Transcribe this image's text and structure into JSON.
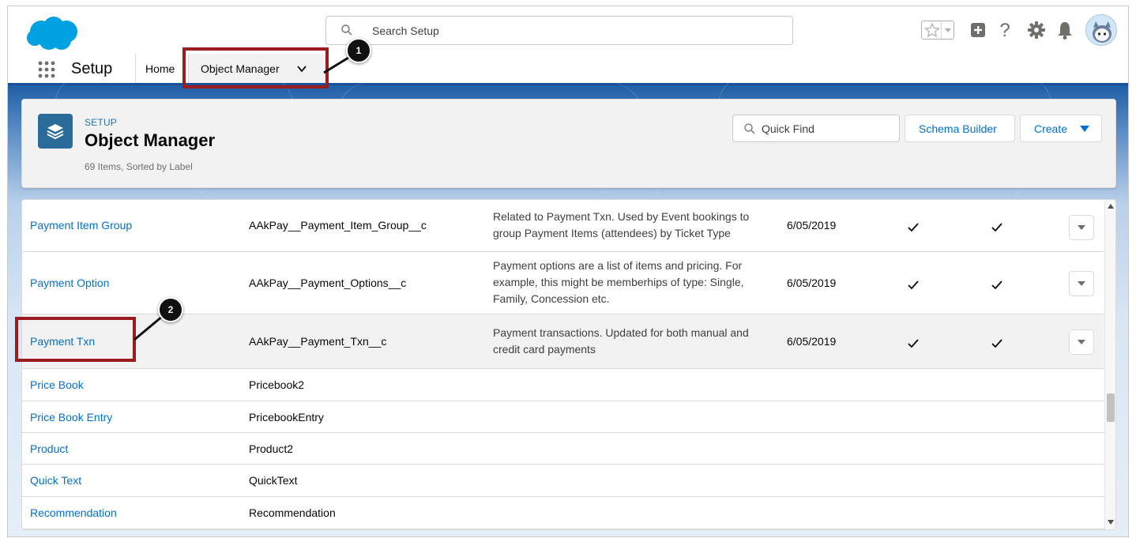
{
  "header": {
    "search_placeholder": "Search Setup",
    "brand_color": "#00a1e0"
  },
  "nav": {
    "app_name": "Setup",
    "home_label": "Home",
    "object_manager_label": "Object Manager"
  },
  "page_header": {
    "eyebrow": "SETUP",
    "title": "Object Manager",
    "meta": "69 Items, Sorted by Label",
    "quick_find_placeholder": "Quick Find",
    "schema_builder_label": "Schema Builder",
    "create_label": "Create"
  },
  "rows": [
    {
      "label": "Payment Item Group",
      "api_name": "AAkPay__Payment_Item_Group__c",
      "description": "Related to Payment Txn. Used by Event bookings to group Payment Items (attendees) by Ticket Type",
      "last_modified": "6/05/2019",
      "deployed": true,
      "custom": true
    },
    {
      "label": "Payment Option",
      "api_name": "AAkPay__Payment_Options__c",
      "description": "Payment options are a list of items and pricing. For example, this might be memberhips of type: Single, Family, Concession etc.",
      "last_modified": "6/05/2019",
      "deployed": true,
      "custom": true
    },
    {
      "label": "Payment Txn",
      "api_name": "AAkPay__Payment_Txn__c",
      "description": "Payment transactions. Updated for both manual and credit card payments",
      "last_modified": "6/05/2019",
      "deployed": true,
      "custom": true
    },
    {
      "label": "Price Book",
      "api_name": "Pricebook2"
    },
    {
      "label": "Price Book Entry",
      "api_name": "PricebookEntry"
    },
    {
      "label": "Product",
      "api_name": "Product2"
    },
    {
      "label": "Quick Text",
      "api_name": "QuickText"
    },
    {
      "label": "Recommendation",
      "api_name": "Recommendation"
    }
  ],
  "annotations": {
    "badge_1": "1",
    "badge_2": "2",
    "callout_color": "#9b1c1f"
  }
}
